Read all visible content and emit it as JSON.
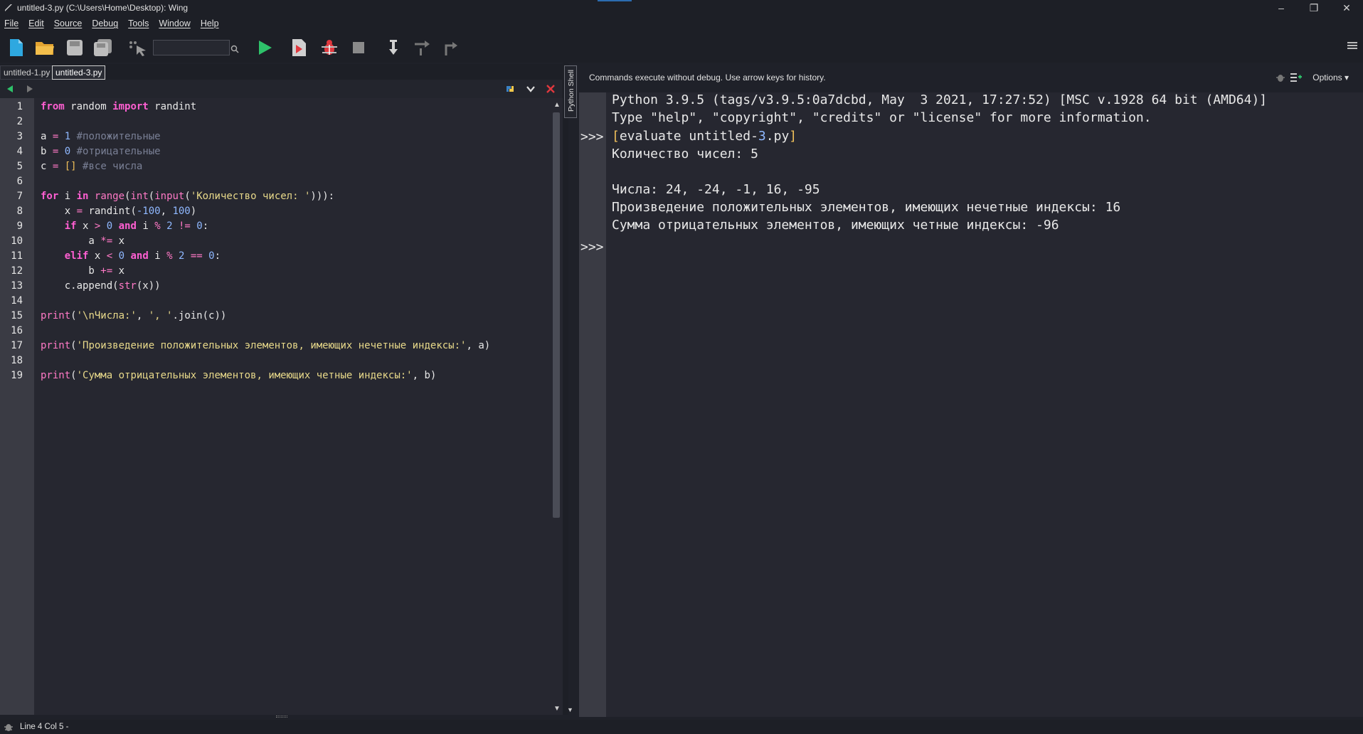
{
  "window": {
    "title": "untitled-3.py (C:\\Users\\Home\\Desktop): Wing",
    "minimize": "–",
    "maximize": "❐",
    "close": "✕"
  },
  "menu": {
    "file": "File",
    "edit": "Edit",
    "source": "Source",
    "debug": "Debug",
    "tools": "Tools",
    "window": "Window",
    "help": "Help"
  },
  "toolbar": {
    "search_value": ""
  },
  "tabs": [
    {
      "label": "untitled-1.py"
    },
    {
      "label": "untitled-3.py"
    }
  ],
  "editor": {
    "line_numbers": [
      "1",
      "2",
      "3",
      "4",
      "5",
      "6",
      "7",
      "8",
      "9",
      "10",
      "11",
      "12",
      "13",
      "14",
      "15",
      "16",
      "17",
      "18",
      "19"
    ]
  },
  "shell": {
    "vertical_tab": "Python Shell",
    "info": "Commands execute without debug.  Use arrow keys for history.",
    "options": "Options",
    "prompt": ">>>",
    "lines": {
      "banner1": "Python 3.9.5 (tags/v3.9.5:0a7dcbd, May  3 2021, 17:27:52) [MSC v.1928 64 bit (AMD64)]",
      "banner2": "Type \"help\", \"copyright\", \"credits\" or \"license\" for more information.",
      "eval_open": "[",
      "eval_text": "evaluate untitled-",
      "eval_num": "3",
      "eval_ext": ".py",
      "eval_close": "]",
      "count": "Количество чисел: 5",
      "numbers": "Числа: 24, -24, -1, 16, -95",
      "product": "Произведение положительных элементов, имеющих нечетные индексы: 16",
      "sum": "Сумма отрицательных элементов, имеющих четные индексы: -96"
    }
  },
  "status": {
    "text": "Line 4 Col 5 -"
  },
  "colors": {
    "background": "#262730",
    "gutter": "#3a3b44",
    "keyword": "#ff5fd2",
    "number": "#8fb8ff",
    "comment": "#7a8096",
    "string": "#e8d98a",
    "run_green": "#2ec26a",
    "close_red": "#e0383e"
  }
}
